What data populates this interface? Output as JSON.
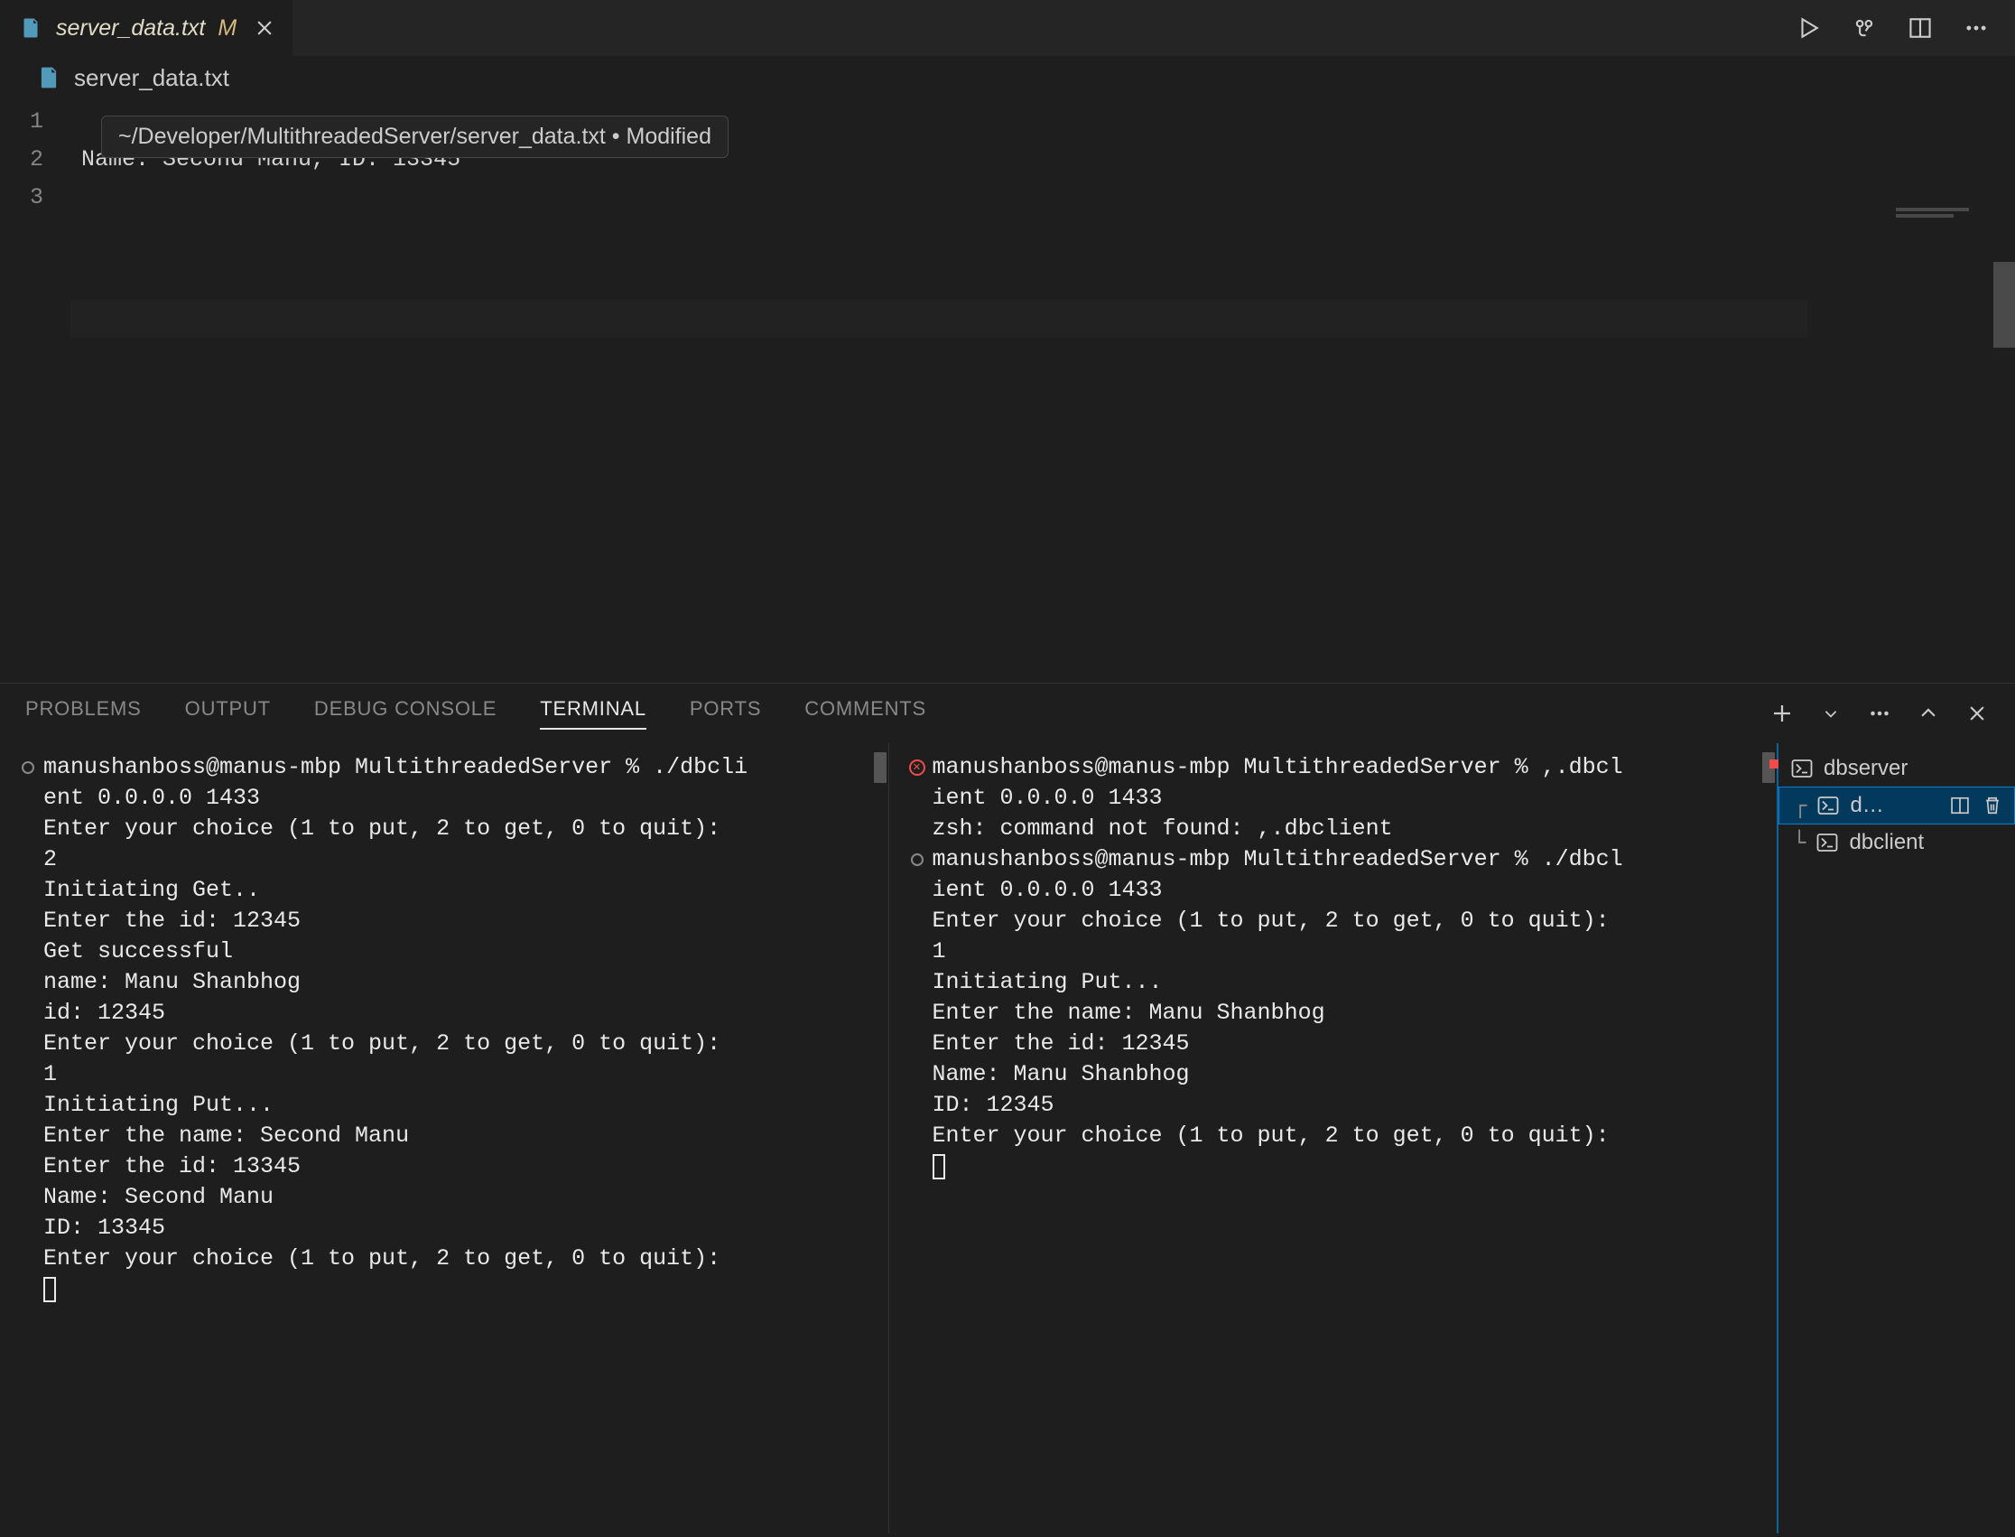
{
  "tab": {
    "name": "server_data.txt",
    "modified_indicator": "M"
  },
  "breadcrumb": {
    "file": "server_data.txt"
  },
  "tooltip": {
    "text": "~/Developer/MultithreadedServer/server_data.txt • Modified"
  },
  "editor": {
    "lines": [
      "1",
      "2",
      "3"
    ],
    "line2": "Name: Second Manu, ID: 13345"
  },
  "panel": {
    "tabs": {
      "problems": "PROBLEMS",
      "output": "OUTPUT",
      "debug": "DEBUG CONSOLE",
      "terminal": "TERMINAL",
      "ports": "PORTS",
      "comments": "COMMENTS"
    }
  },
  "terminal": {
    "left": [
      "manushanboss@manus-mbp MultithreadedServer % ./dbcli",
      "ent 0.0.0.0 1433",
      "Enter your choice (1 to put, 2 to get, 0 to quit):",
      "2",
      "Initiating Get..",
      "Enter the id: 12345",
      "Get successful",
      "name: Manu Shanbhog",
      "id: 12345",
      "Enter your choice (1 to put, 2 to get, 0 to quit):",
      "1",
      "Initiating Put...",
      "Enter the name: Second Manu",
      "Enter the id: 13345",
      "Name: Second Manu",
      "ID: 13345",
      "Enter your choice (1 to put, 2 to get, 0 to quit):"
    ],
    "right": [
      "manushanboss@manus-mbp MultithreadedServer % ,.dbcl",
      "ient 0.0.0.0 1433",
      "zsh: command not found: ,.dbclient",
      "manushanboss@manus-mbp MultithreadedServer % ./dbcl",
      "ient 0.0.0.0 1433",
      "Enter your choice (1 to put, 2 to get, 0 to quit):",
      "1",
      "Initiating Put...",
      "Enter the name: Manu Shanbhog",
      "Enter the id: 12345",
      "Name: Manu Shanbhog",
      "ID: 12345",
      "Enter your choice (1 to put, 2 to get, 0 to quit):"
    ]
  },
  "term_sidebar": {
    "items": {
      "server": "dbserver",
      "client1_full": "dbclient",
      "client1_trunc": "d…",
      "client2": "dbclient"
    }
  }
}
